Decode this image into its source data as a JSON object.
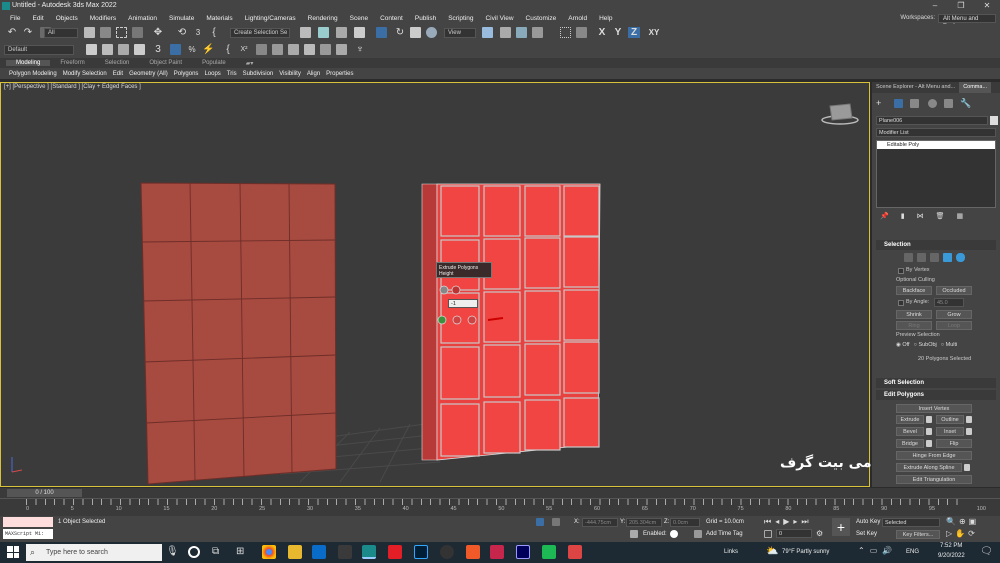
{
  "window": {
    "title": "Untitled - Autodesk 3ds Max 2022",
    "controls": [
      "–",
      "❐",
      "✕"
    ]
  },
  "menu": [
    "File",
    "Edit",
    "Objects",
    "Modifiers",
    "Animation",
    "Simulate",
    "Materials",
    "Lighting/Cameras",
    "Rendering",
    "Scene",
    "Content",
    "Publish",
    "Scripting",
    "Civil View",
    "Customize",
    "Arnold",
    "Help"
  ],
  "workspaces": {
    "label": "Workspaces:",
    "value": "Alt Menu and Toolbar"
  },
  "toolbar": {
    "filter_dropdown": "All",
    "selection_set": "Create Selection Se",
    "view_dropdown": "View",
    "layer_dropdown": "Default",
    "axis_x": "X",
    "axis_y": "Y",
    "axis_z": "Z",
    "axis_xy": "XY"
  },
  "ribbon_tabs": [
    "Modeling",
    "Freeform",
    "Selection",
    "Object Paint",
    "Populate"
  ],
  "ribbon_items": [
    "Polygon Modeling",
    "Modify Selection",
    "Edit",
    "Geometry (All)",
    "Polygons",
    "Loops",
    "Tris",
    "Subdivision",
    "Visibility",
    "Align",
    "Properties"
  ],
  "viewport": {
    "label": "[+] [Perspective ] [Standard ] [Clay + Edged Faces ]",
    "watermark": "آکادمی بیت گرف",
    "caddy": {
      "title": "Extrude Polygons",
      "param": "Height",
      "value": "-1"
    }
  },
  "command_panel": {
    "tabs": [
      "Scene Explorer - Alt Menu and...",
      "Comma..."
    ],
    "object_name": "Plane006",
    "modifier_list": "Modifier List",
    "stack_item": "Editable Poly",
    "selection": {
      "title": "Selection",
      "by_vertex": "By Vertex",
      "ignore_backfacing": "Optional Culling",
      "backface": "Backface",
      "occluded": "Occluded",
      "by_angle": "By Angle:",
      "by_angle_value": "45.0",
      "shrink": "Shrink",
      "grow": "Grow",
      "ring": "Ring",
      "loop": "Loop",
      "preview_selection": "Preview Selection",
      "off": "Off",
      "subobj": "SubObj",
      "multi": "Multi",
      "status": "20 Polygons Selected"
    },
    "soft_selection": "Soft Selection",
    "edit_polygons": {
      "title": "Edit Polygons",
      "insert_vertex": "Insert Vertex",
      "extrude": "Extrude",
      "outline": "Outline",
      "bevel": "Bevel",
      "inset": "Inset",
      "bridge": "Bridge",
      "flip": "Flip",
      "hinge": "Hinge From Edge",
      "extrude_spline": "Extrude Along Spline",
      "edit_triangulation": "Edit Triangulation"
    }
  },
  "timeline": {
    "slider": "0 / 100",
    "ticks": [
      "0",
      "5",
      "10",
      "15",
      "20",
      "25",
      "30",
      "35",
      "40",
      "45",
      "50",
      "55",
      "60",
      "65",
      "70",
      "75",
      "80",
      "85",
      "90",
      "95",
      "100"
    ]
  },
  "status": {
    "maxscript": "MAXScript Mi:",
    "selected": "1 Object Selected",
    "x_label": "X:",
    "x_value": "-444.75cm",
    "y_label": "Y:",
    "y_value": "205.304cm",
    "z_label": "Z:",
    "z_value": "0.0cm",
    "grid": "Grid = 10.0cm",
    "enabled": "Enabled:",
    "add_time_tag": "Add Time Tag",
    "auto_key": "Auto Key",
    "auto_key_mode": "Selected",
    "set_key": "Set Key",
    "key_filters": "Key Filters...",
    "frame": "0"
  },
  "taskbar": {
    "search": "Type here to search",
    "links": "Links",
    "weather": "79°F  Partly sunny",
    "lang": "ENG",
    "time": "7:52 PM",
    "date": "9/20/2022"
  },
  "colors": {
    "left_plane": "#a74a40",
    "right_plane": "#e8413f",
    "viewport_bg": "#3b3b3b",
    "active_border": "#d8c23a"
  }
}
